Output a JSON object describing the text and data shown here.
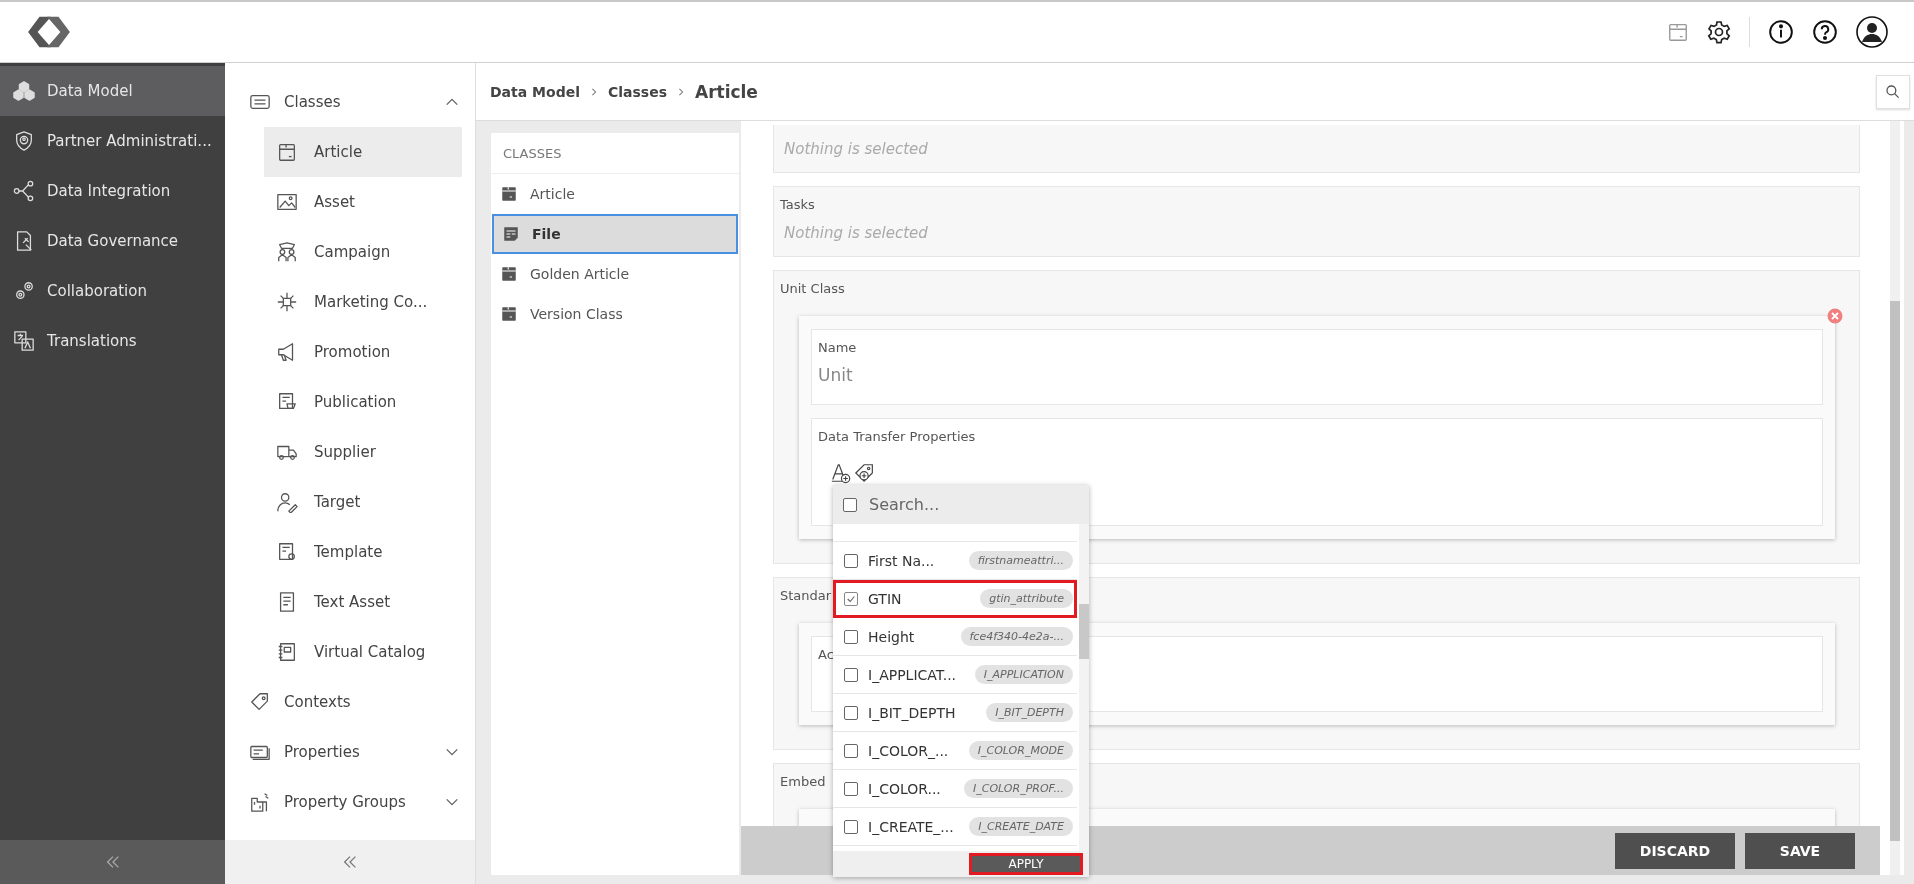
{
  "nav": {
    "items": [
      {
        "label": "Data Model",
        "selected": true
      },
      {
        "label": "Partner Administrati...",
        "selected": false
      },
      {
        "label": "Data Integration",
        "selected": false
      },
      {
        "label": "Data Governance",
        "selected": false
      },
      {
        "label": "Collaboration",
        "selected": false
      },
      {
        "label": "Translations",
        "selected": false
      }
    ]
  },
  "subnav": {
    "items": [
      {
        "label": "Classes",
        "expanded": true,
        "children": [
          {
            "label": "Article",
            "selected": true
          },
          {
            "label": "Asset",
            "selected": false
          },
          {
            "label": "Campaign",
            "selected": false
          },
          {
            "label": "Marketing Co...",
            "selected": false
          },
          {
            "label": "Promotion",
            "selected": false
          },
          {
            "label": "Publication",
            "selected": false
          },
          {
            "label": "Supplier",
            "selected": false
          },
          {
            "label": "Target",
            "selected": false
          },
          {
            "label": "Template",
            "selected": false
          },
          {
            "label": "Text Asset",
            "selected": false
          },
          {
            "label": "Virtual Catalog",
            "selected": false
          }
        ]
      },
      {
        "label": "Contexts"
      },
      {
        "label": "Properties",
        "expanded": false
      },
      {
        "label": "Property Groups",
        "expanded": false
      }
    ]
  },
  "breadcrumb": [
    "Data Model",
    "Classes",
    "Article"
  ],
  "classes_panel": {
    "heading": "CLASSES",
    "items": [
      {
        "label": "Article",
        "selected": false
      },
      {
        "label": "File",
        "selected": true
      },
      {
        "label": "Golden Article",
        "selected": false
      },
      {
        "label": "Version Class",
        "selected": false
      }
    ]
  },
  "form": {
    "sections": [
      {
        "kind": "empty",
        "placeholder": "Nothing is selected"
      },
      {
        "kind": "empty",
        "label": "Tasks",
        "placeholder": "Nothing is selected"
      },
      {
        "kind": "object",
        "label": "Unit Class",
        "removable": true,
        "fields": [
          {
            "kind": "text",
            "label": "Name",
            "value": "Unit"
          },
          {
            "kind": "icons",
            "label": "Data Transfer Properties"
          }
        ]
      },
      {
        "kind": "object",
        "label": "Standar",
        "fields": [
          {
            "kind": "text",
            "label": "Ac"
          }
        ]
      },
      {
        "kind": "object",
        "label": "Embed"
      }
    ]
  },
  "dropdown": {
    "placeholder": "Search...",
    "select_all": false,
    "items": [
      {
        "label": "First Na...",
        "tag": "firstnameattri...",
        "checked": false,
        "highlighted": false
      },
      {
        "label": "GTIN",
        "tag": "gtin_attribute",
        "checked": true,
        "highlighted": true
      },
      {
        "label": "Height",
        "tag": "fce4f340-4e2a-...",
        "checked": false,
        "highlighted": false
      },
      {
        "label": "I_APPLICAT...",
        "tag": "I_APPLICATION",
        "checked": false,
        "highlighted": false
      },
      {
        "label": "I_BIT_DEPTH",
        "tag": "I_BIT_DEPTH",
        "checked": false,
        "highlighted": false
      },
      {
        "label": "I_COLOR_...",
        "tag": "I_COLOR_MODE",
        "checked": false,
        "highlighted": false
      },
      {
        "label": "I_COLOR...",
        "tag": "I_COLOR_PROF...",
        "checked": false,
        "highlighted": false
      },
      {
        "label": "I_CREATE_...",
        "tag": "I_CREATE_DATE",
        "checked": false,
        "highlighted": false
      }
    ],
    "apply": {
      "label": "APPLY",
      "highlighted": true
    }
  },
  "actions": [
    "DISCARD",
    "SAVE"
  ]
}
